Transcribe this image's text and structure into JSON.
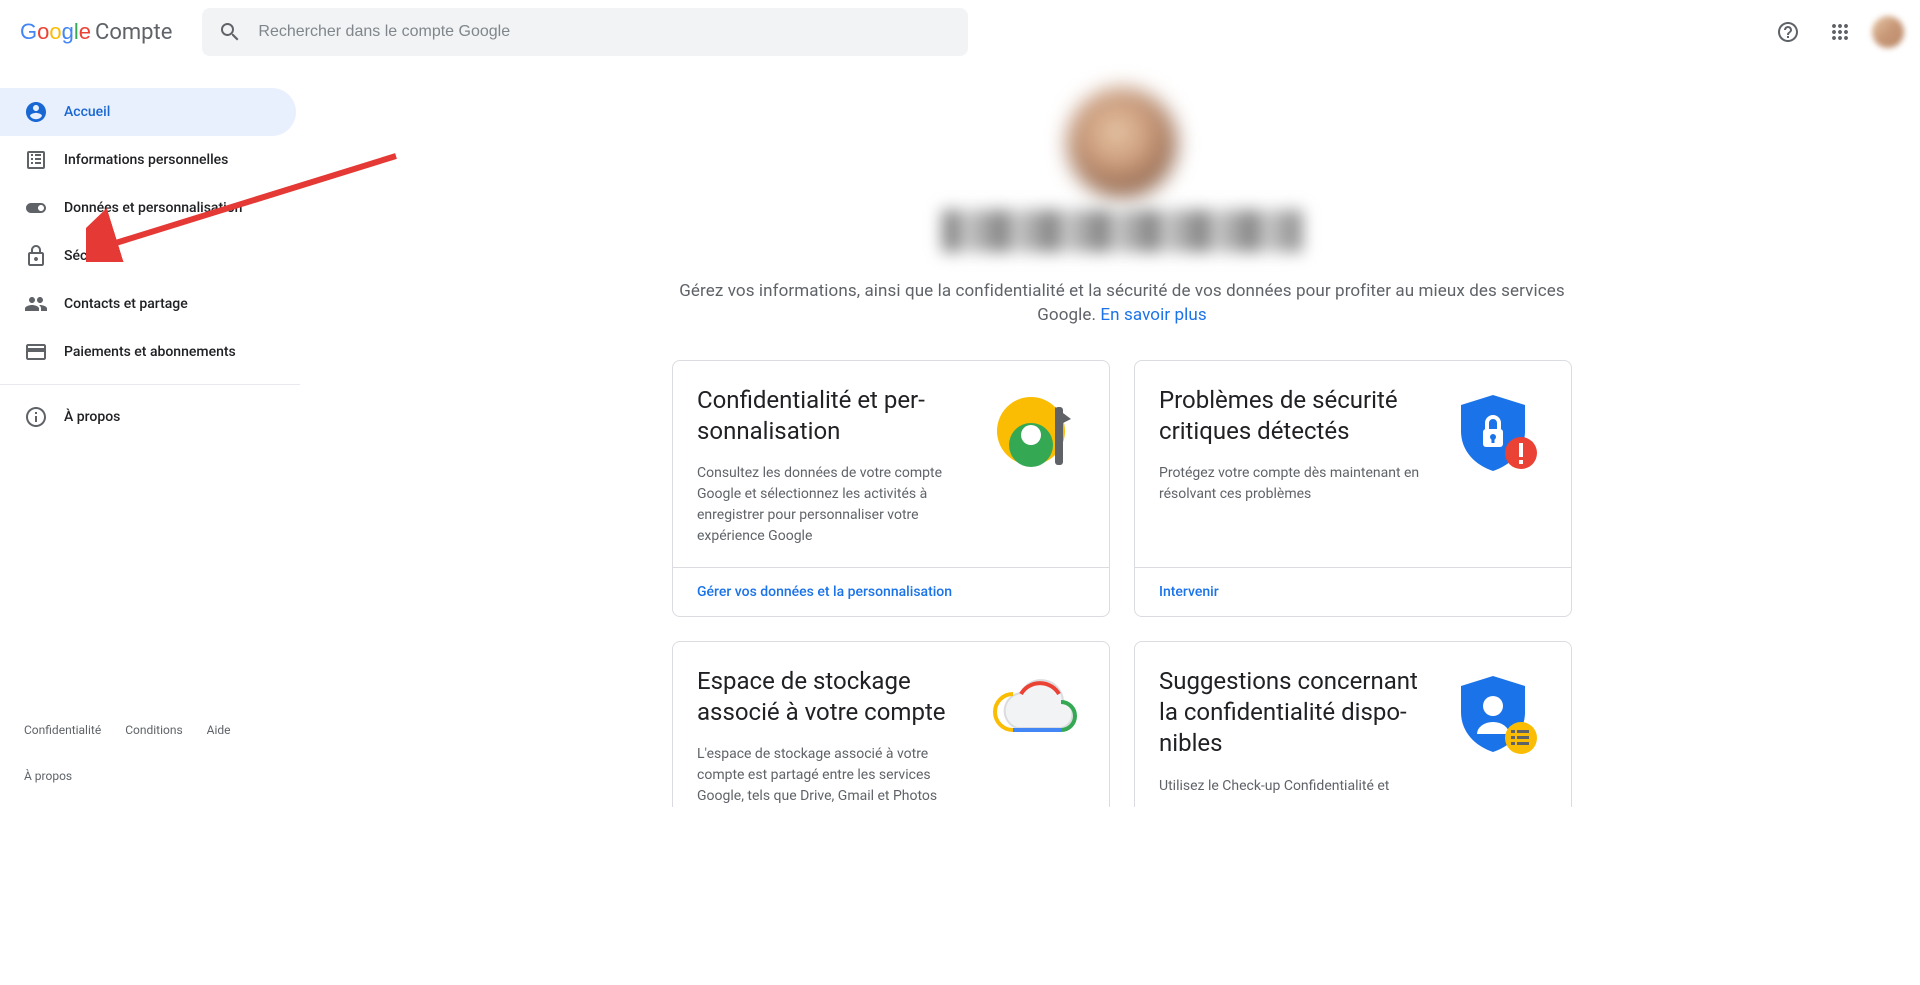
{
  "header": {
    "product": "Compte",
    "search_placeholder": "Rechercher dans le compte Google"
  },
  "sidebar": {
    "items": [
      {
        "label": "Accueil"
      },
      {
        "label": "Informations personnelles"
      },
      {
        "label": "Données et personnalisation"
      },
      {
        "label": "Sécurité"
      },
      {
        "label": "Contacts et partage"
      },
      {
        "label": "Paiements et abonnements"
      }
    ],
    "about": "À propos"
  },
  "main": {
    "intro": "Gérez vos informations, ainsi que la confidentialité et la sécurité de vos données pour profiter au mieux des services Google. ",
    "intro_link": "En savoir plus"
  },
  "cards": [
    {
      "title": "Confidentialité et per­sonnalisation",
      "desc": "Consultez les données de votre compte Google et sélectionnez les ac­tivités à enregistrer pour personnali­ser votre expérience Google",
      "action": "Gérer vos données et la personnalisation"
    },
    {
      "title": "Problèmes de sécurité critiques détectés",
      "desc": "Protégez votre compte dès mainte­nant en résolvant ces problèmes",
      "action": "Intervenir"
    },
    {
      "title": "Espace de stockage asso­cié à votre compte",
      "desc": "L'espace de stockage associé à votre compte est partagé entre les services Google, tels que Drive, Gmail et Photos",
      "action": ""
    },
    {
      "title": "Suggestions concernant la confidentialité dispo­nibles",
      "desc": "Utilisez le Check-up Confidentialité et",
      "action": ""
    }
  ],
  "footer": {
    "privacy": "Confidentialité",
    "terms": "Conditions",
    "help": "Aide",
    "about": "À propos"
  }
}
